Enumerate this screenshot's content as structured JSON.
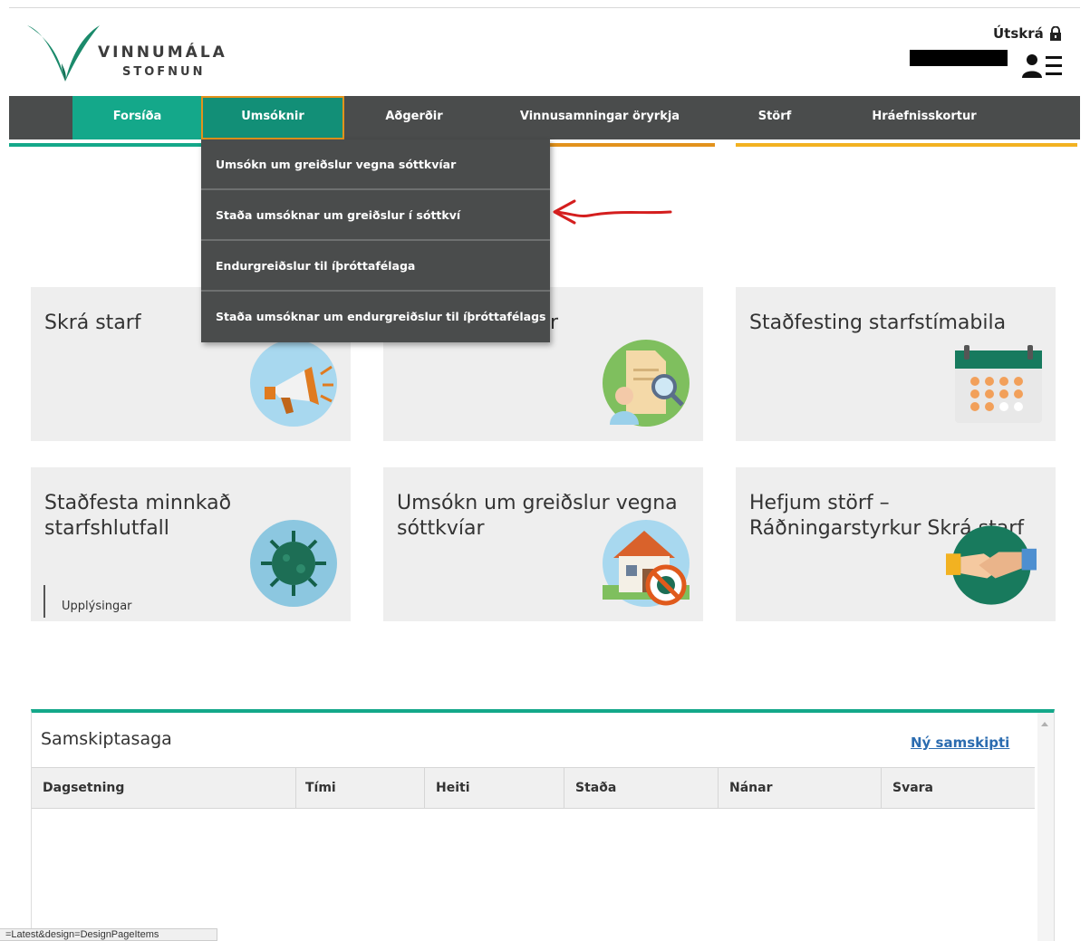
{
  "header": {
    "logo_line1": "VINNUMÁLA",
    "logo_line2": "STOFNUN",
    "logout_label": "Útskrá"
  },
  "nav": {
    "items": [
      {
        "label": "Forsíða"
      },
      {
        "label": "Umsóknir"
      },
      {
        "label": "Aðgerðir"
      },
      {
        "label": "Vinnusamningar öryrkja"
      },
      {
        "label": "Störf"
      },
      {
        "label": "Hráefnisskortur"
      }
    ]
  },
  "dropdown": {
    "items": [
      {
        "label": "Umsókn um greiðslur vegna sóttkvíar"
      },
      {
        "label": "Staða umsóknar um greiðslur í sóttkví"
      },
      {
        "label": "Endurgreiðslur til íþróttafélaga"
      },
      {
        "label": "Staða umsóknar um endurgreiðslur til íþróttafélags"
      }
    ]
  },
  "tiles": [
    {
      "title": "Skrá starf",
      "icon": "megaphone-icon"
    },
    {
      "title": "r",
      "icon": "document-search-icon"
    },
    {
      "title": "Staðfesting starfstímabila",
      "icon": "calendar-icon"
    },
    {
      "title": "Staðfesta minnkað starfshlutfall",
      "icon": "virus-icon",
      "link": "Upplýsingar"
    },
    {
      "title": "Umsókn um greiðslur vegna sóttkvíar",
      "icon": "house-virus-icon"
    },
    {
      "title": "Hefjum störf – Ráðningarstyrkur Skrá starf",
      "icon": "handshake-icon"
    }
  ],
  "history": {
    "title": "Samskiptasaga",
    "new_link": "Ný samskipti",
    "columns": [
      "Dagsetning",
      "Tími",
      "Heiti",
      "Staða",
      "Nánar",
      "Svara"
    ],
    "rows": []
  },
  "statusbar": {
    "text": "=Latest&design=DesignPageItems"
  },
  "colors": {
    "brand_green": "#14a88a",
    "nav_dark": "#4a4c4c",
    "accent_orange": "#e2921c",
    "accent_yellow": "#f2b221"
  }
}
